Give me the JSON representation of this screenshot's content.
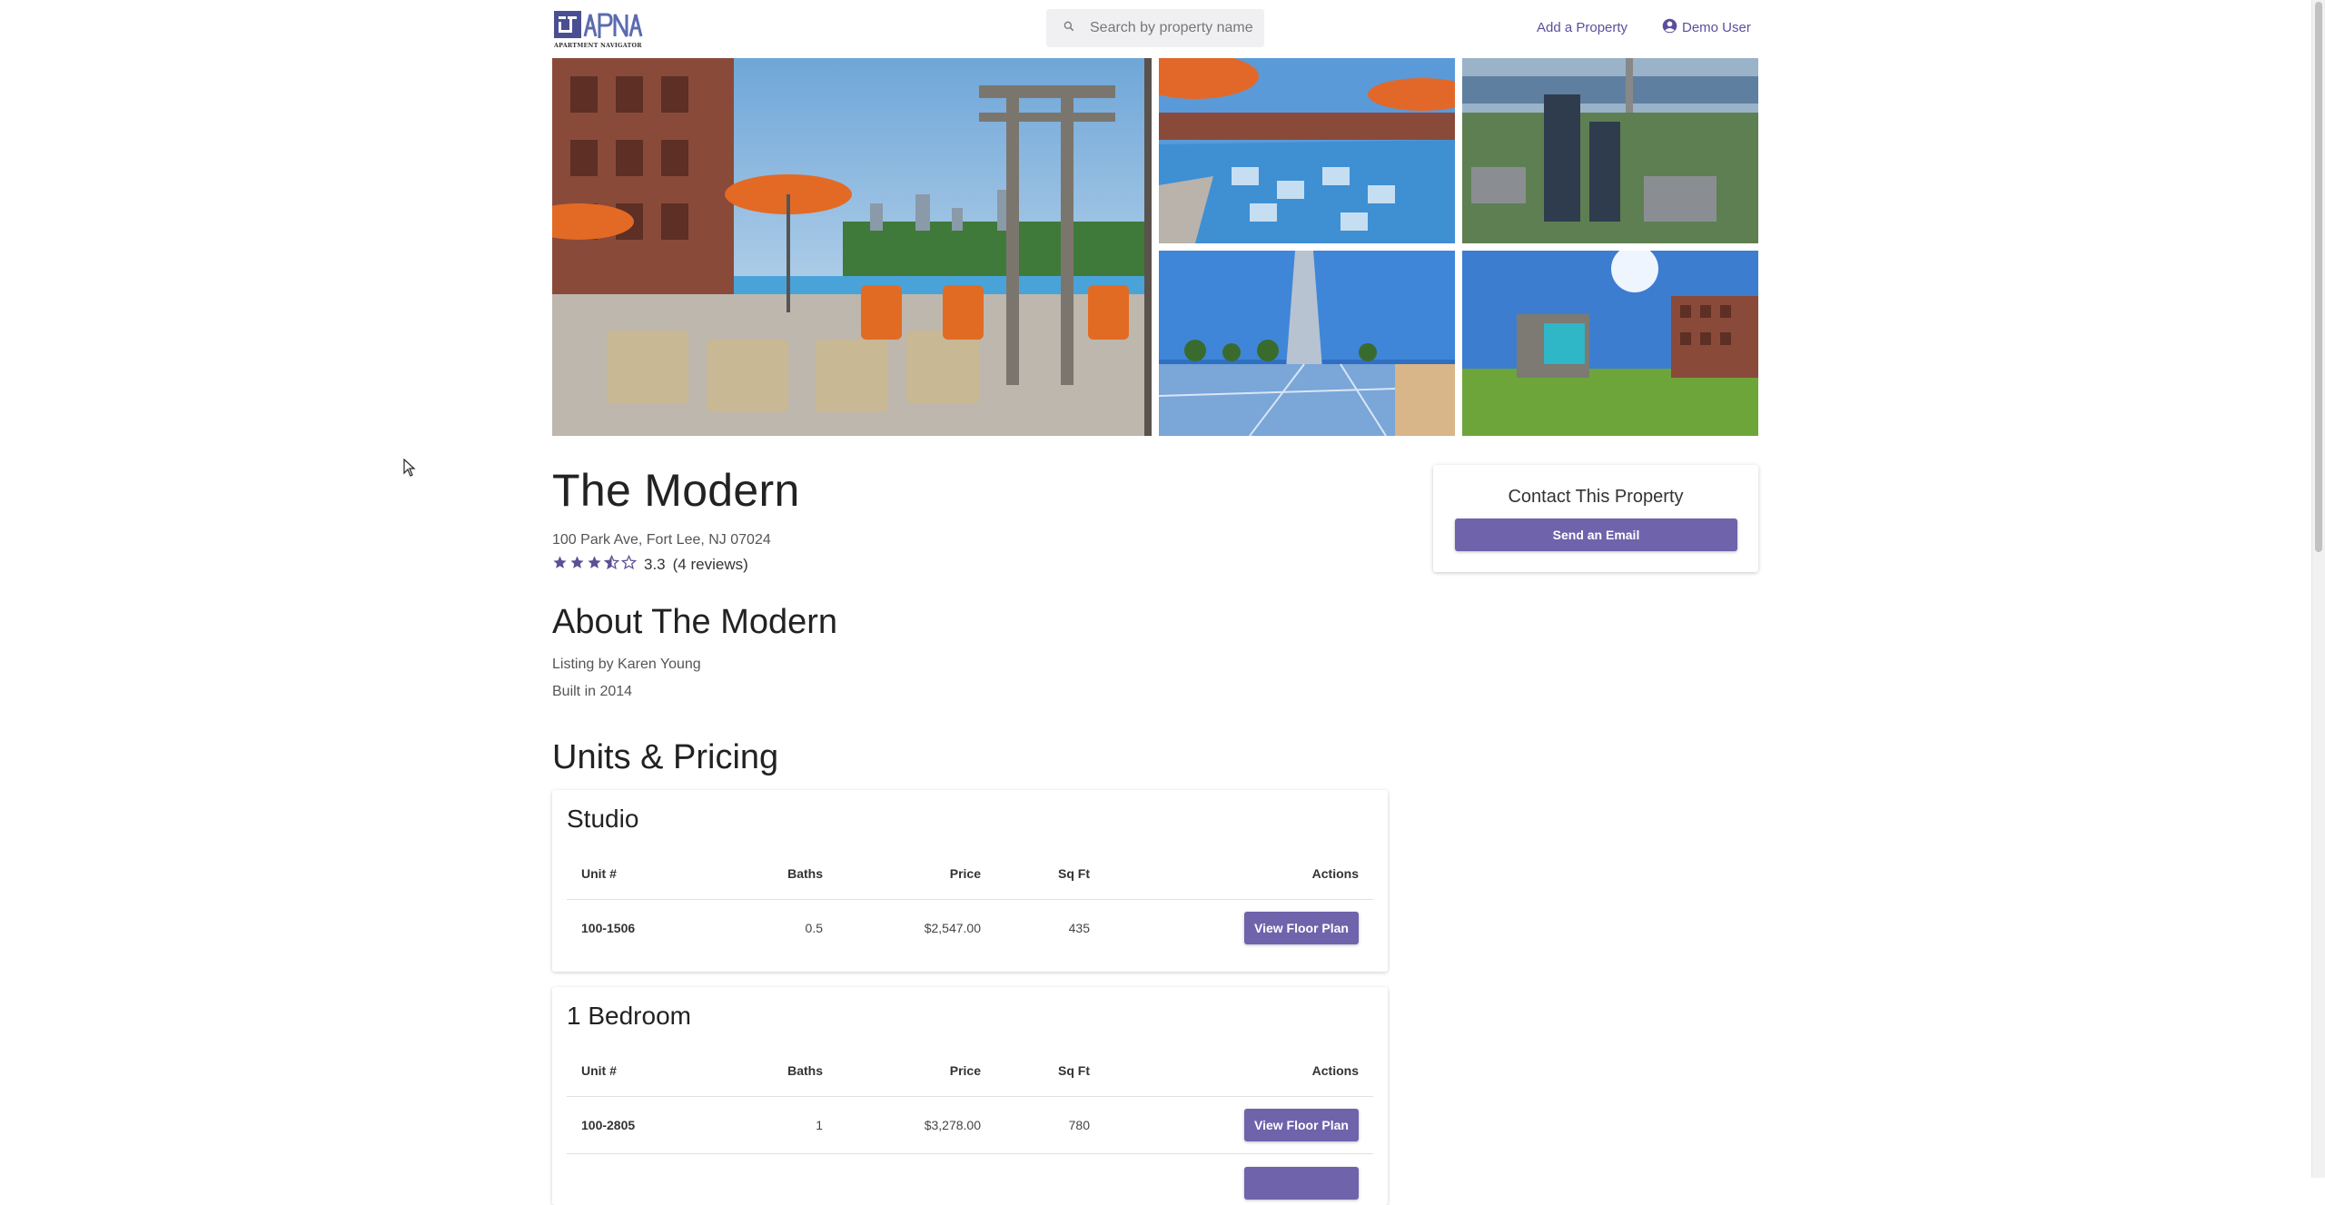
{
  "header": {
    "logo_text": "apna",
    "logo_subtext": "APARTMENT NAVIGATOR",
    "search_placeholder": "Search by property name",
    "add_property_label": "Add a Property",
    "user_label": "Demo User"
  },
  "gallery": {
    "photos": [
      "pool-deck-lounge",
      "rooftop-pool",
      "aerial-city-view",
      "basketball-court",
      "lawn-courtyard"
    ]
  },
  "property": {
    "name": "The Modern",
    "address": "100 Park Ave, Fort Lee, NJ 07024",
    "rating": "3.3",
    "rating_value": 3.3,
    "rating_max": 5,
    "review_count": "(4 reviews)"
  },
  "about": {
    "heading": "About The Modern",
    "listing_by": "Listing by Karen Young",
    "built": "Built in 2014"
  },
  "contact": {
    "heading": "Contact This Property",
    "button_label": "Send an Email"
  },
  "units": {
    "heading": "Units & Pricing",
    "columns": [
      "Unit #",
      "Baths",
      "Price",
      "Sq Ft",
      "Actions"
    ],
    "groups": [
      {
        "name": "Studio",
        "rows": [
          {
            "unit": "100-1506",
            "baths": "0.5",
            "price": "$2,547.00",
            "sqft": "435",
            "action": "View Floor Plan"
          }
        ]
      },
      {
        "name": "1 Bedroom",
        "rows": [
          {
            "unit": "100-2805",
            "baths": "1",
            "price": "$3,278.00",
            "sqft": "780",
            "action": "View Floor Plan"
          }
        ]
      }
    ]
  },
  "colors": {
    "accent": "#6f63ab",
    "link": "#5a4f9c",
    "star": "#5b5096"
  },
  "icons": [
    "search-icon",
    "account-circle-icon",
    "star-icon",
    "star-half-icon",
    "star-outline-icon"
  ]
}
